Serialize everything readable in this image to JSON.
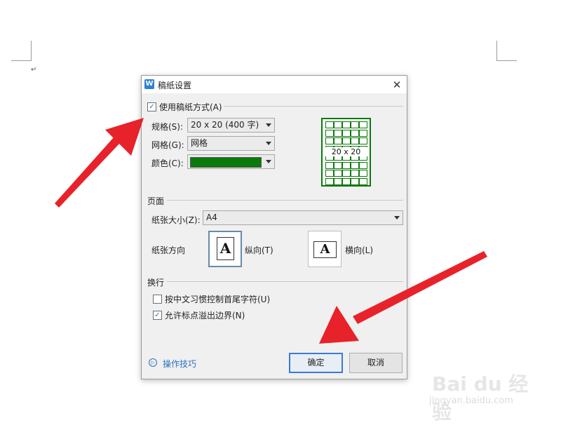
{
  "document": {
    "paragraph_mark": "↵"
  },
  "dialog": {
    "title": "稿纸设置",
    "app_icon": "W",
    "close_glyph": "✕",
    "use_grid_paper": {
      "label": "使用稿纸方式(A)",
      "checked": true,
      "check_glyph": "✓"
    },
    "spec": {
      "label": "规格(S):",
      "value": "20 x 20 (400 字)"
    },
    "grid": {
      "label": "网格(G):",
      "value": "网格"
    },
    "color": {
      "label": "颜色(C):",
      "value": "#0a7a0a"
    },
    "preview": {
      "text": "20 x 20",
      "color": "#0b7a0b"
    },
    "page": {
      "group_label": "页面",
      "paper_size": {
        "label": "纸张大小(Z):",
        "value": "A4"
      },
      "orientation": {
        "label": "纸张方向",
        "portrait": {
          "label": "纵向(T)",
          "icon_glyph": "A",
          "selected": true
        },
        "landscape": {
          "label": "横向(L)",
          "icon_glyph": "A",
          "selected": false
        }
      }
    },
    "line_break": {
      "group_label": "换行",
      "chinese_rules": {
        "label": "按中文习惯控制首尾字符(U)",
        "checked": false
      },
      "punctuation_overflow": {
        "label": "允许标点溢出边界(N)",
        "checked": true,
        "check_glyph": "✓"
      }
    },
    "tips": {
      "label": "操作技巧",
      "icon_glyph": "▷"
    },
    "ok_button": "确定",
    "cancel_button": "取消"
  },
  "watermark": {
    "main": "Bai du 经验",
    "sub": "jingyan.baidu.com"
  },
  "colors": {
    "accent": "#2c6fbf",
    "arrow": "#e8222a",
    "grid_green": "#0b7a0b"
  }
}
